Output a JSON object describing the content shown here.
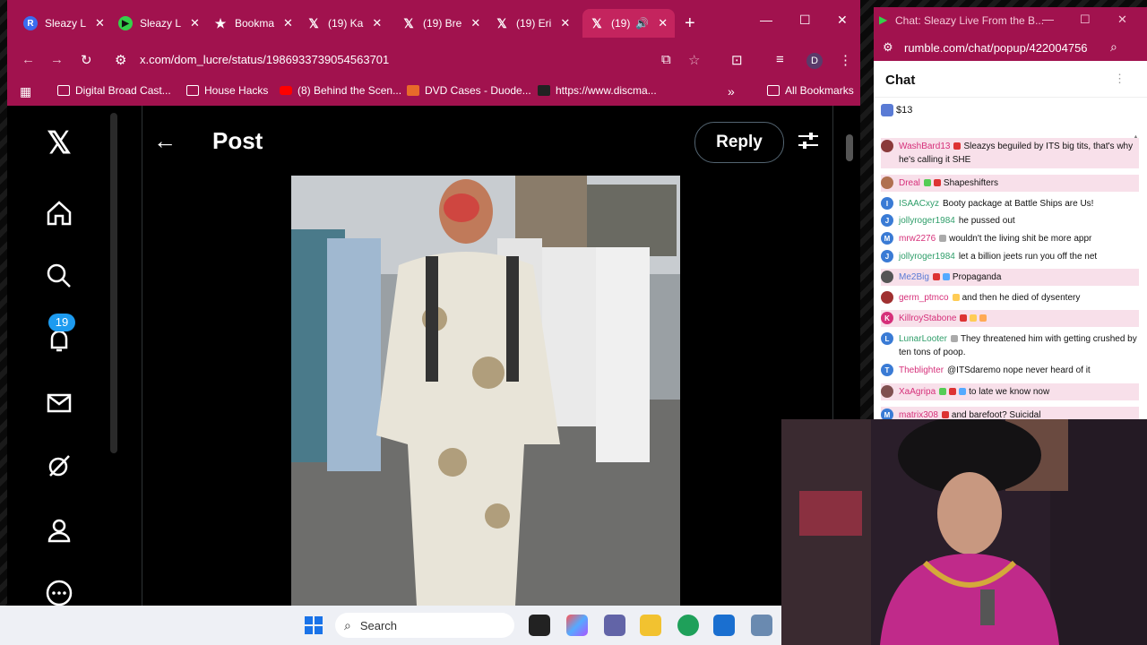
{
  "browser": {
    "tabs": [
      {
        "label": "Sleazy L",
        "icon": "rumble-r-icon",
        "color": "#3b6cf0"
      },
      {
        "label": "Sleazy L",
        "icon": "rumble-play-icon",
        "color": "#35d04a"
      },
      {
        "label": "Bookma",
        "icon": "star-icon",
        "color": "#ffffff"
      },
      {
        "label": "(19) Ka",
        "icon": "x-logo-icon",
        "color": "#ffffff"
      },
      {
        "label": "(19) Bre",
        "icon": "x-logo-icon",
        "color": "#ffffff"
      },
      {
        "label": "(19) Eri",
        "icon": "x-logo-icon",
        "color": "#ffffff"
      },
      {
        "label": "(19)",
        "icon": "x-logo-icon",
        "color": "#ffffff"
      }
    ],
    "new_tab": "+",
    "url": "x.com/dom_lucre/status/1986933739054563701",
    "profile_initial": "D",
    "bookmarks": [
      {
        "label": "Digital Broad Cast..."
      },
      {
        "label": "House Hacks"
      },
      {
        "label": "(8) Behind the Scen..."
      },
      {
        "label": "DVD Cases - Duode..."
      },
      {
        "label": "https://www.discma..."
      }
    ],
    "more_bookmarks": "»",
    "all_bookmarks": "All Bookmarks"
  },
  "x": {
    "title": "Post",
    "reply": "Reply",
    "notification_count": "19"
  },
  "taskbar": {
    "search_placeholder": "Search"
  },
  "chat": {
    "window_title": "Chat: Sleazy Live From the B...",
    "url": "rumble.com/chat/popup/422004756",
    "header": "Chat",
    "pinned_amount": "$13",
    "messages": [
      {
        "user": "WashBard13",
        "text": "Sleazys beguiled by ITS big tits, that's why he's calling it SHE",
        "ucolor": "#d6307a",
        "avatar": "",
        "avcolor": "#8a3a3a",
        "highlight": true
      },
      {
        "user": "Dreal",
        "text": "Shapeshifters",
        "ucolor": "#d6307a",
        "avatar": "",
        "avcolor": "#b07050",
        "highlight": true
      },
      {
        "user": "ISAACxyz",
        "text": "Booty package at Battle Ships are Us!",
        "ucolor": "#2f9e6a",
        "avatar": "I",
        "avcolor": "#3a7bd5",
        "highlight": false
      },
      {
        "user": "jollyroger1984",
        "text": "he pussed out",
        "ucolor": "#2f9e6a",
        "avatar": "J",
        "avcolor": "#3a7bd5",
        "highlight": false
      },
      {
        "user": "mrw2276",
        "text": "wouldn't the living shit be more appr",
        "ucolor": "#d6307a",
        "avatar": "M",
        "avcolor": "#3a7bd5",
        "highlight": false
      },
      {
        "user": "jollyroger1984",
        "text": "let a billion jeets run you off the net",
        "ucolor": "#2f9e6a",
        "avatar": "J",
        "avcolor": "#3a7bd5",
        "highlight": false
      },
      {
        "user": "Me2Big",
        "text": "Propaganda",
        "ucolor": "#5a7bd5",
        "avatar": "",
        "avcolor": "#555555",
        "highlight": true
      },
      {
        "user": "germ_ptmco",
        "text": "and then he died of dysentery",
        "ucolor": "#d6307a",
        "avatar": "",
        "avcolor": "#a03030",
        "highlight": false
      },
      {
        "user": "KillroyStabone",
        "text": "",
        "ucolor": "#d6307a",
        "avatar": "K",
        "avcolor": "#d6307a",
        "highlight": true
      },
      {
        "user": "LunarLooter",
        "text": "They threatened him with getting crushed by ten tons of poop.",
        "ucolor": "#2f9e6a",
        "avatar": "L",
        "avcolor": "#3a7bd5",
        "highlight": false
      },
      {
        "user": "Theblighter",
        "text": "@ITSdaremo nope never heard of it",
        "ucolor": "#d6307a",
        "avatar": "T",
        "avcolor": "#3a7bd5",
        "highlight": false
      },
      {
        "user": "XaAgripa",
        "text": "to late we know now",
        "ucolor": "#d6307a",
        "avatar": "",
        "avcolor": "#805050",
        "highlight": true
      },
      {
        "user": "matrix308",
        "text": "and barefoot? Suicidal",
        "ucolor": "#d6307a",
        "avatar": "M",
        "avcolor": "#3a7bd5",
        "highlight": true
      }
    ]
  },
  "colors": {
    "accent": "#a1124e",
    "x_blue": "#1d9bf0"
  }
}
